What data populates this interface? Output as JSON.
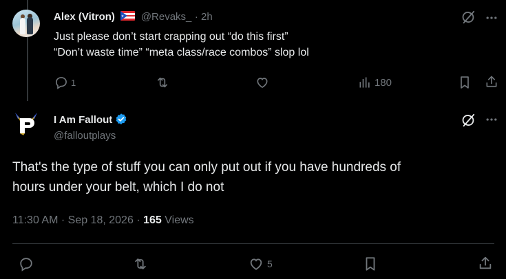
{
  "reply": {
    "author_name": "Alex (Vitron)",
    "handle": "@Revaks_",
    "time": "2h",
    "text_line1": "Just please don’t start crapping out “do this first”",
    "text_line2": "“Don’t waste time” “meta class/race combos” slop lol",
    "reply_count": "1",
    "view_count": "180"
  },
  "main_post": {
    "author_name": "I Am Fallout",
    "handle": "@falloutplays",
    "text_line1": "That's the type of stuff you can only put out if you have hundreds of",
    "text_line2": "hours under your belt, which I do not",
    "time": "11:30 AM",
    "date": "Sep 18, 2026",
    "views_count": "165",
    "views_label": "Views",
    "like_count": "5"
  },
  "colors": {
    "background": "#000000",
    "text_primary": "#e7e9ea",
    "text_secondary": "#71767b",
    "verified_blue": "#1d9bf0",
    "divider": "#2f3336"
  },
  "icons": [
    "grok-icon",
    "more-icon",
    "reply-icon",
    "repost-icon",
    "like-icon",
    "views-icon",
    "bookmark-icon",
    "share-icon",
    "verified-icon",
    "puerto-rico-flag-icon"
  ]
}
